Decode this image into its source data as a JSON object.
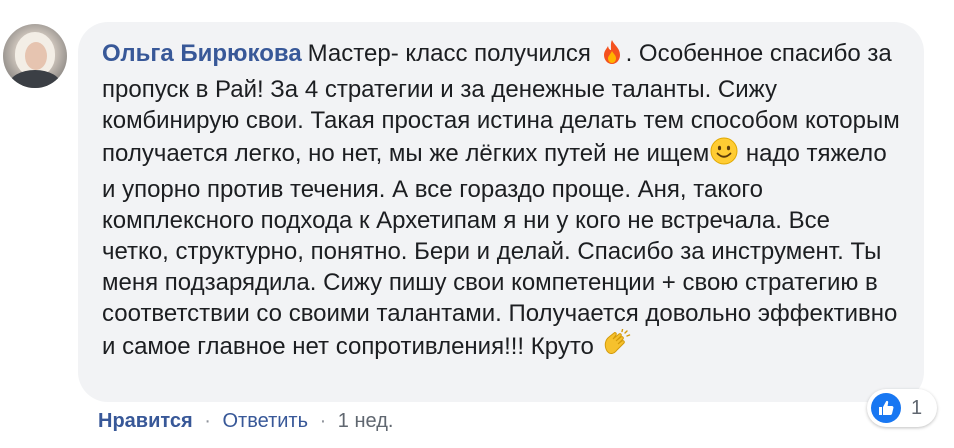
{
  "comment": {
    "author": "Ольга Бирюкова",
    "text_part1": "Мастер- класс получился",
    "emoji1": "fire-emoji",
    "text_part2": ". Особенное спасибо за пропуск в Рай! За 4 стратегии и за денежные таланты. Сижу комбинирую свои. Такая простая истина делать тем способом которым получается легко, но нет, мы же лёгких путей не ищем",
    "emoji2": "smiling-face-emoji",
    "text_part3": "надо тяжело и упорно против течения. А все гораздо проще. Аня, такого комплексного подхода к Архетипам я ни у кого не встречала. Все четко, структурно, понятно. Бери и делай. Спасибо за инструмент. Ты меня подзарядила. Сижу пишу свои компетенции + свою стратегию в соответствии со своими талантами. Получается довольно эффективно и самое главное нет сопротивления!!! Круто",
    "emoji3": "clapping-hands-emoji"
  },
  "actions": {
    "like_label": "Нравится",
    "separator": "·",
    "reply_label": "Ответить",
    "time": "1 нед."
  },
  "reactions": {
    "icon": "like-thumb-icon",
    "count": "1"
  },
  "colors": {
    "link": "#385898",
    "bubble": "#f2f3f5",
    "like_blue": "#1877f2",
    "meta": "#606770"
  }
}
